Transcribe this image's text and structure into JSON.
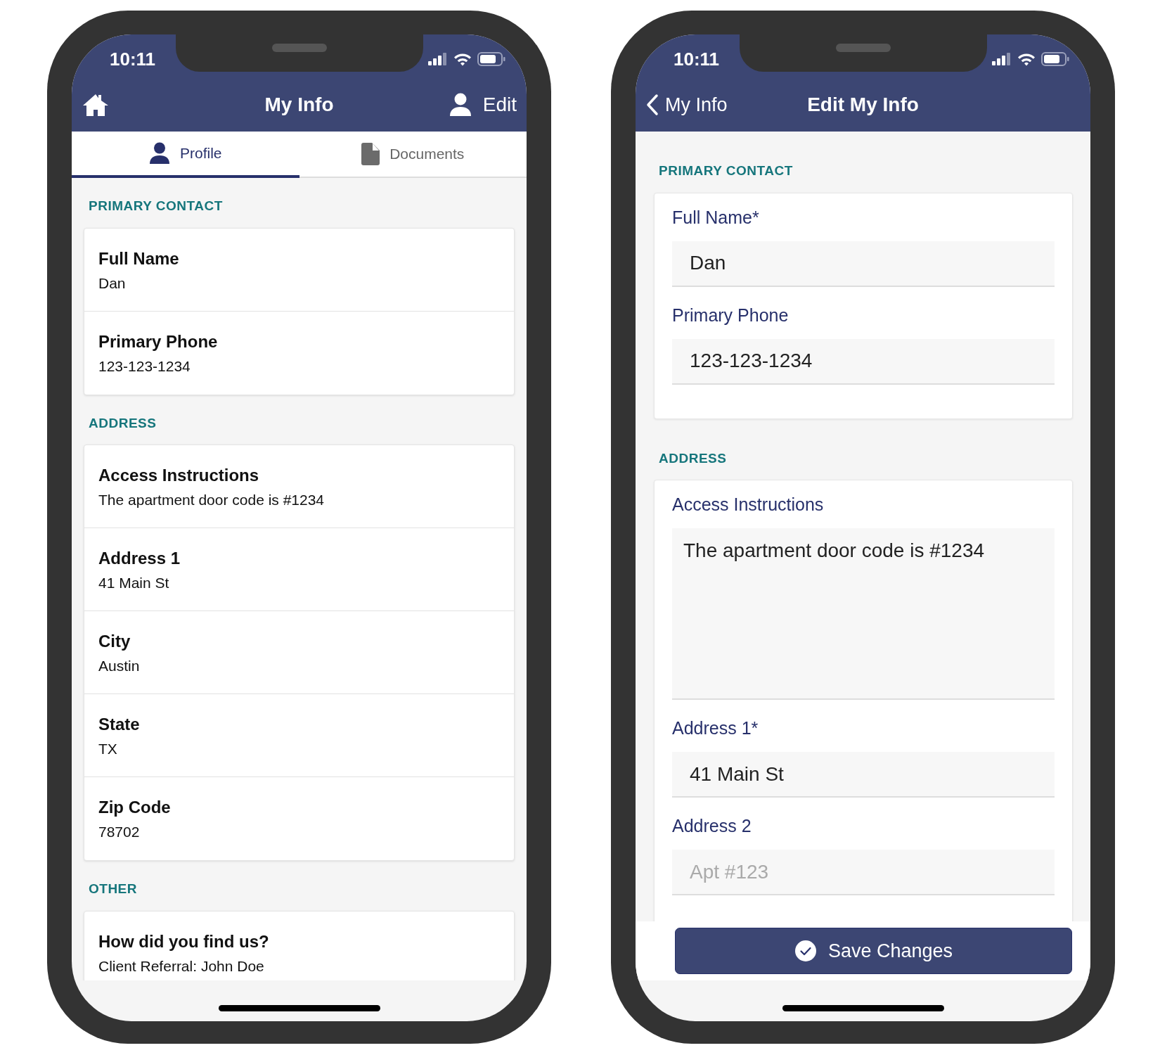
{
  "screens": [
    {
      "kind": "view",
      "status_bar": {
        "time": "10:11"
      },
      "nav": {
        "title": "My Info",
        "action": "Edit"
      },
      "tabs": [
        {
          "label": "Profile",
          "selected": true
        },
        {
          "label": "Documents",
          "selected": false
        }
      ],
      "sections": [
        {
          "title": "PRIMARY CONTACT",
          "fields": [
            {
              "label": "Full Name",
              "value": "Dan"
            },
            {
              "label": "Primary Phone",
              "value": "123-123-1234"
            }
          ]
        },
        {
          "title": "ADDRESS",
          "fields": [
            {
              "label": "Access Instructions",
              "value": "The apartment door code is #1234"
            },
            {
              "label": "Address 1",
              "value": "41 Main St"
            },
            {
              "label": "City",
              "value": "Austin"
            },
            {
              "label": "State",
              "value": "TX"
            },
            {
              "label": "Zip Code",
              "value": "78702"
            }
          ]
        },
        {
          "title": "OTHER",
          "fields": [
            {
              "label": "How did you find us?",
              "value": "Client Referral: John Doe"
            }
          ]
        }
      ]
    },
    {
      "kind": "edit",
      "status_bar": {
        "time": "10:11"
      },
      "nav": {
        "back": "My Info",
        "title": "Edit My Info"
      },
      "sections": [
        {
          "title": "PRIMARY CONTACT",
          "fields": [
            {
              "kind": "input",
              "label": "Full Name*",
              "value": "Dan"
            },
            {
              "kind": "input",
              "label": "Primary Phone",
              "value": "123-123-1234"
            }
          ]
        },
        {
          "title": "ADDRESS",
          "fields": [
            {
              "kind": "textarea",
              "label": "Access Instructions",
              "value": "The apartment door code is #1234"
            },
            {
              "kind": "input",
              "label": "Address 1*",
              "value": "41 Main St"
            },
            {
              "kind": "input",
              "label": "Address 2",
              "placeholder": "Apt #123"
            }
          ]
        }
      ],
      "save_button": "Save Changes"
    }
  ]
}
